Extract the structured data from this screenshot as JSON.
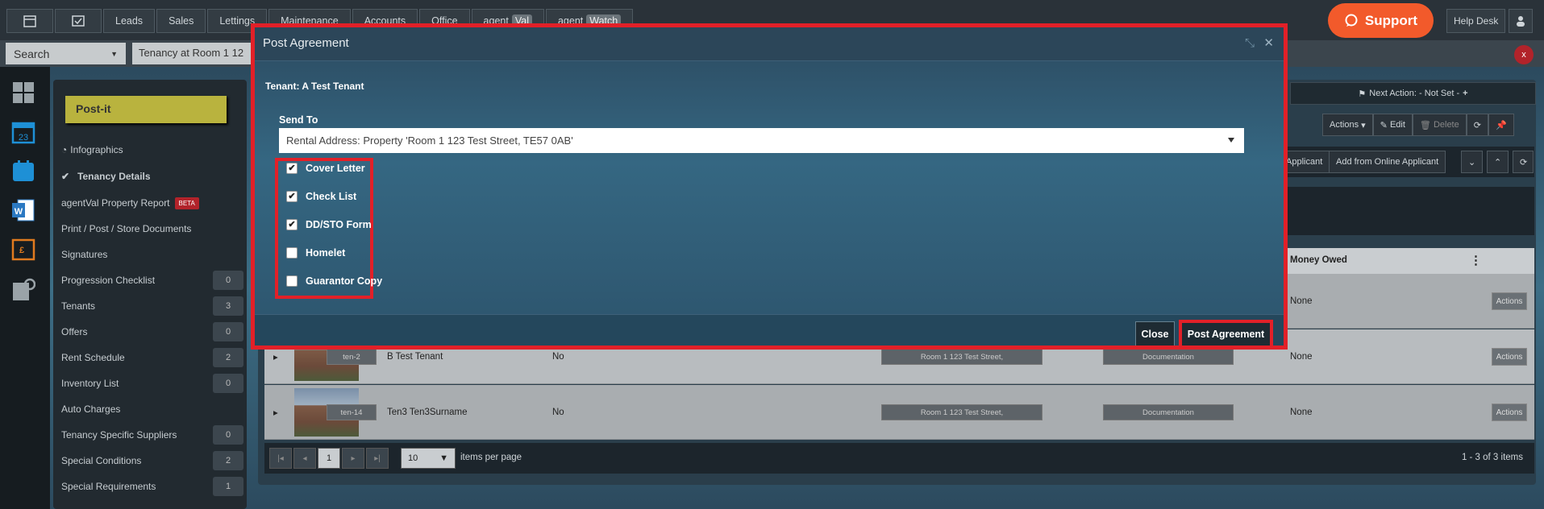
{
  "topnav": {
    "tabs": [
      "Leads",
      "Sales",
      "Lettings",
      "Maintenance",
      "Accounts",
      "Office"
    ],
    "agent_val": {
      "label": "agent",
      "badge": "Val"
    },
    "agent_watch": {
      "label": "agent",
      "badge": "Watch"
    },
    "support_label": "Support",
    "helpdesk_label": "Help Desk"
  },
  "searchbar": {
    "search_label": "Search",
    "breadcrumb": "Tenancy at Room 1 12",
    "close_label": "x"
  },
  "sidebar": {
    "postit": "Post-it",
    "items": [
      {
        "label": "Infographics",
        "count": ""
      },
      {
        "label": "Tenancy Details",
        "count": ""
      },
      {
        "label": "agentVal Property Report",
        "count": "",
        "badge": "BETA"
      },
      {
        "label": "Print / Post / Store Documents",
        "count": ""
      },
      {
        "label": "Signatures",
        "count": ""
      },
      {
        "label": "Progression Checklist",
        "count": "0"
      },
      {
        "label": "Tenants",
        "count": "3"
      },
      {
        "label": "Offers",
        "count": "0"
      },
      {
        "label": "Rent Schedule",
        "count": "2"
      },
      {
        "label": "Inventory List",
        "count": "0"
      },
      {
        "label": "Auto Charges",
        "count": ""
      },
      {
        "label": "Tenancy Specific Suppliers",
        "count": "0"
      },
      {
        "label": "Special Conditions",
        "count": "2"
      },
      {
        "label": "Special Requirements",
        "count": "1"
      }
    ]
  },
  "main": {
    "next_action": "Next Action: - Not Set -",
    "toolbar": {
      "actions": "Actions",
      "edit": "Edit",
      "delete": "Delete"
    },
    "toolbar2": {
      "applicant": "Applicant",
      "add_online": "Add from Online Applicant"
    },
    "table": {
      "money_owed_header": "Money Owed",
      "rows": [
        {
          "ref": "",
          "name": "",
          "col": "",
          "address": "",
          "status": "",
          "money": "None",
          "action": "Actions"
        },
        {
          "ref": "ten-2",
          "name": "B Test Tenant",
          "col": "No",
          "address": "Room 1 123 Test Street,",
          "status": "Documentation",
          "money": "None",
          "action": "Actions"
        },
        {
          "ref": "ten-14",
          "name": "Ten3 Ten3Surname",
          "col": "No",
          "address": "Room 1 123 Test Street,",
          "status": "Documentation",
          "money": "None",
          "action": "Actions"
        }
      ]
    },
    "pager": {
      "page": "1",
      "per_page": "10",
      "per_page_label": "items per page",
      "summary": "1 - 3 of 3 items"
    }
  },
  "dialog": {
    "title": "Post Agreement",
    "tenant_label": "Tenant: A Test Tenant",
    "send_to_label": "Send To",
    "send_to_value": "Rental Address: Property 'Room 1 123 Test Street, TE57 0AB'",
    "options": [
      {
        "label": "Cover Letter",
        "checked": true
      },
      {
        "label": "Check List",
        "checked": true
      },
      {
        "label": "DD/STO Form",
        "checked": true
      },
      {
        "label": "Homelet",
        "checked": false
      },
      {
        "label": "Guarantor Copy",
        "checked": false
      }
    ],
    "close_label": "Close",
    "post_label": "Post Agreement"
  },
  "colors": {
    "accent_red": "#e22028",
    "support_orange": "#f25a2b",
    "dialog_bg": "#2b4a5e"
  }
}
